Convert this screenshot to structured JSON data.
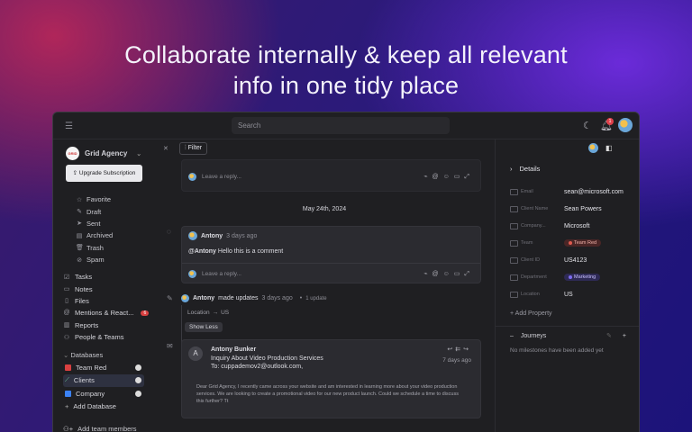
{
  "headline": {
    "line1": "Collaborate internally & keep all relevant",
    "line2": "info in one tidy place"
  },
  "topbar": {
    "search_placeholder": "Search",
    "notification_count": "1"
  },
  "workspace": {
    "logo_text": "GRID",
    "name": "Grid Agency",
    "upgrade_label": "Upgrade Subscription"
  },
  "mail_nav": [
    {
      "icon": "star-icon",
      "label": "Favorite"
    },
    {
      "icon": "draft-icon",
      "label": "Draft"
    },
    {
      "icon": "send-icon",
      "label": "Sent"
    },
    {
      "icon": "archive-icon",
      "label": "Archived"
    },
    {
      "icon": "trash-icon",
      "label": "Trash"
    },
    {
      "icon": "spam-icon",
      "label": "Spam"
    }
  ],
  "main_nav": [
    {
      "icon": "tasks-icon",
      "label": "Tasks"
    },
    {
      "icon": "notes-icon",
      "label": "Notes"
    },
    {
      "icon": "files-icon",
      "label": "Files"
    },
    {
      "icon": "at-icon",
      "label": "Mentions & React...",
      "badge": "6"
    },
    {
      "icon": "reports-icon",
      "label": "Reports"
    },
    {
      "icon": "people-icon",
      "label": "People & Teams"
    }
  ],
  "databases": {
    "heading": "Databases",
    "items": [
      {
        "label": "Team Red",
        "color": "#d94040"
      },
      {
        "label": "Clients",
        "color": "#4caf7a"
      },
      {
        "label": "Company",
        "color": "#3b82f6"
      }
    ],
    "add_label": "Add Database",
    "add_members_label": "Add team members"
  },
  "feed": {
    "filter_label": "Filter",
    "reply_placeholder": "Leave a reply...",
    "date_divider": "May 24th, 2024",
    "comment": {
      "author": "Antony",
      "time": "3 days ago",
      "mention": "@Antony",
      "text": " Hello this is a comment"
    },
    "update": {
      "author": "Antony",
      "action": "made updates",
      "time": "3 days ago",
      "count": "1 update",
      "field": "Location",
      "arrow": "→",
      "value": "US",
      "show_less": "Show Less"
    },
    "email": {
      "avatar_letter": "A",
      "sender": "Antony Bunker",
      "subject": "Inquiry About Video Production Services",
      "to": "To: cuppademov2@outlook.com,",
      "time": "7 days ago",
      "body": "Dear Grid Agency, I recently came across your website and am interested in learning more about your video production services. We are looking to create a promotional video for our new product launch. Could we schedule a time to discuss this further? Tt"
    }
  },
  "details": {
    "title": "Details",
    "properties": [
      {
        "label": "Email",
        "value": "sean@microsoft.com"
      },
      {
        "label": "Client Name",
        "value": "Sean Powers"
      },
      {
        "label": "Company...",
        "value": "Microsoft"
      },
      {
        "label": "Team",
        "value": "Team Red",
        "tag_color": "#e05a4f"
      },
      {
        "label": "Client ID",
        "value": "US4123"
      },
      {
        "label": "Department",
        "value": "Marketing",
        "tag_color": "#7d6cf0"
      },
      {
        "label": "Location",
        "value": "US"
      }
    ],
    "add_property": "Add Property",
    "journeys_title": "Journeys",
    "journeys_empty": "No milestones have been added yet"
  }
}
